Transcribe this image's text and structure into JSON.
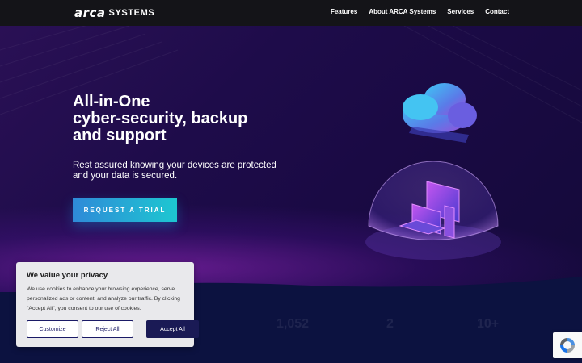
{
  "header": {
    "logo_mark": "arca",
    "logo_text": "SYSTEMS",
    "nav": [
      "Features",
      "About ARCA Systems",
      "Services",
      "Contact"
    ]
  },
  "hero": {
    "title_lines": [
      "All-in-One",
      "cyber-security, backup",
      "and support"
    ],
    "subtitle": "Rest assured knowing your devices are protected and your data is secured.",
    "cta_label": "REQUEST A TRIAL",
    "illustration": "cloud-and-shielded-devices-illustration"
  },
  "stats": [
    "1,052",
    "2",
    "10+"
  ],
  "cookie_banner": {
    "title": "We value your privacy",
    "text": "We use cookies to enhance your browsing experience, serve personalized ads or content, and analyze our traffic. By clicking \"Accept All\", you consent to our use of cookies.",
    "customize_label": "Customize",
    "reject_label": "Reject All",
    "accept_label": "Accept All"
  },
  "recaptcha": {
    "icon": "recaptcha-icon"
  },
  "colors": {
    "cta_start": "#2f8ad8",
    "cta_end": "#1dc7d1",
    "hero_bg": "#1e0c4a",
    "accept_bg": "#1a1a55"
  }
}
